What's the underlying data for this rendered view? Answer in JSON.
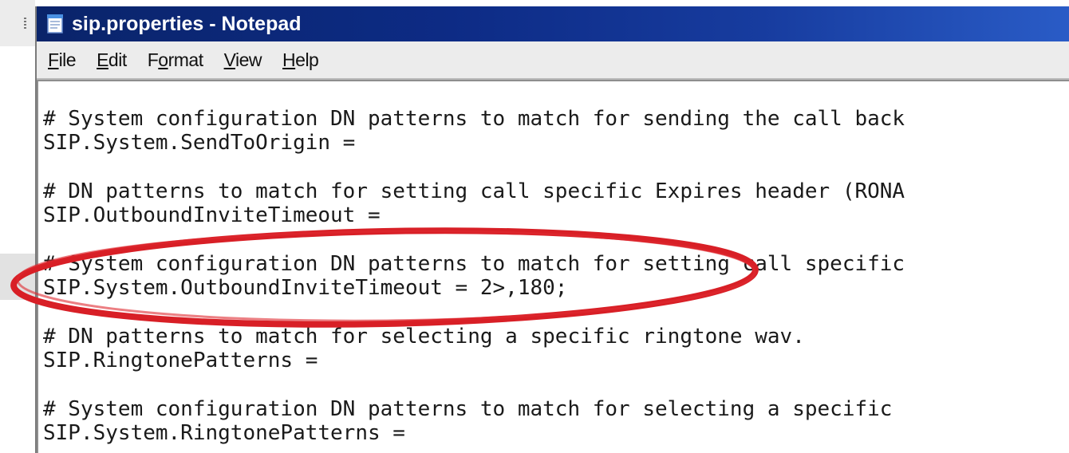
{
  "window": {
    "title": "sip.properties - Notepad",
    "app_icon": "notepad-icon"
  },
  "menu": [
    {
      "label": "File",
      "mnemonic": "F"
    },
    {
      "label": "Edit",
      "mnemonic": "E"
    },
    {
      "label": "Format",
      "mnemonic": "o"
    },
    {
      "label": "View",
      "mnemonic": "V"
    },
    {
      "label": "Help",
      "mnemonic": "H"
    }
  ],
  "editor": {
    "lines": [
      "# System configuration DN patterns to match for sending the call back",
      "SIP.System.SendToOrigin =",
      "",
      "# DN patterns to match for setting call specific Expires header (RONA",
      "SIP.OutboundInviteTimeout =",
      "",
      "# System configuration DN patterns to match for setting call specific",
      "SIP.System.OutboundInviteTimeout = 2>,180;",
      "",
      "# DN patterns to match for selecting a specific ringtone wav.",
      "SIP.RingtonePatterns =",
      "",
      "# System configuration DN patterns to match for selecting a specific",
      "SIP.System.RingtonePatterns ="
    ]
  },
  "colors": {
    "titlebar": "#0a246a",
    "annotation": "#d81f26"
  }
}
